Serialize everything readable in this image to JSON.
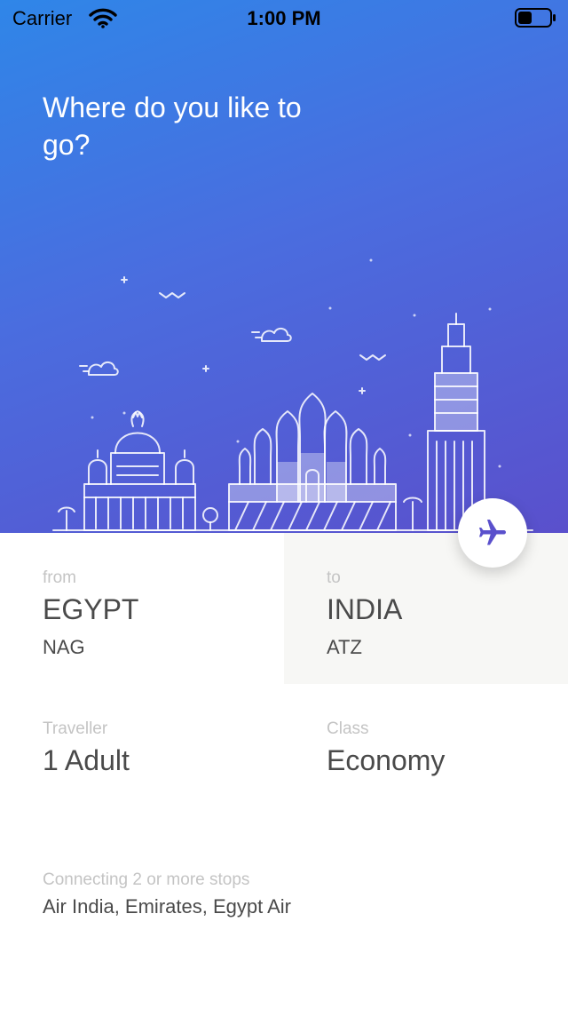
{
  "status_bar": {
    "carrier": "Carrier",
    "time": "1:00 PM"
  },
  "hero": {
    "headline": "Where do you like to go?"
  },
  "route": {
    "from": {
      "label": "from",
      "country": "EGYPT",
      "code": "NAG"
    },
    "to": {
      "label": "to",
      "country": "INDIA",
      "code": "ATZ"
    }
  },
  "traveller": {
    "label": "Traveller",
    "value": "1 Adult"
  },
  "travel_class": {
    "label": "Class",
    "value": "Economy"
  },
  "stops": {
    "label": "Connecting 2 or more stops",
    "airlines": "Air India, Emirates, Egypt Air"
  },
  "colors": {
    "gradient_start": "#2f86e8",
    "gradient_end": "#5a50cc",
    "accent": "#5a50cc",
    "text_primary": "#4a4a4a",
    "text_muted": "#c4c4c4",
    "panel_alt": "#f7f7f5"
  },
  "icons": [
    "wifi-icon",
    "battery-icon",
    "airplane-icon"
  ]
}
